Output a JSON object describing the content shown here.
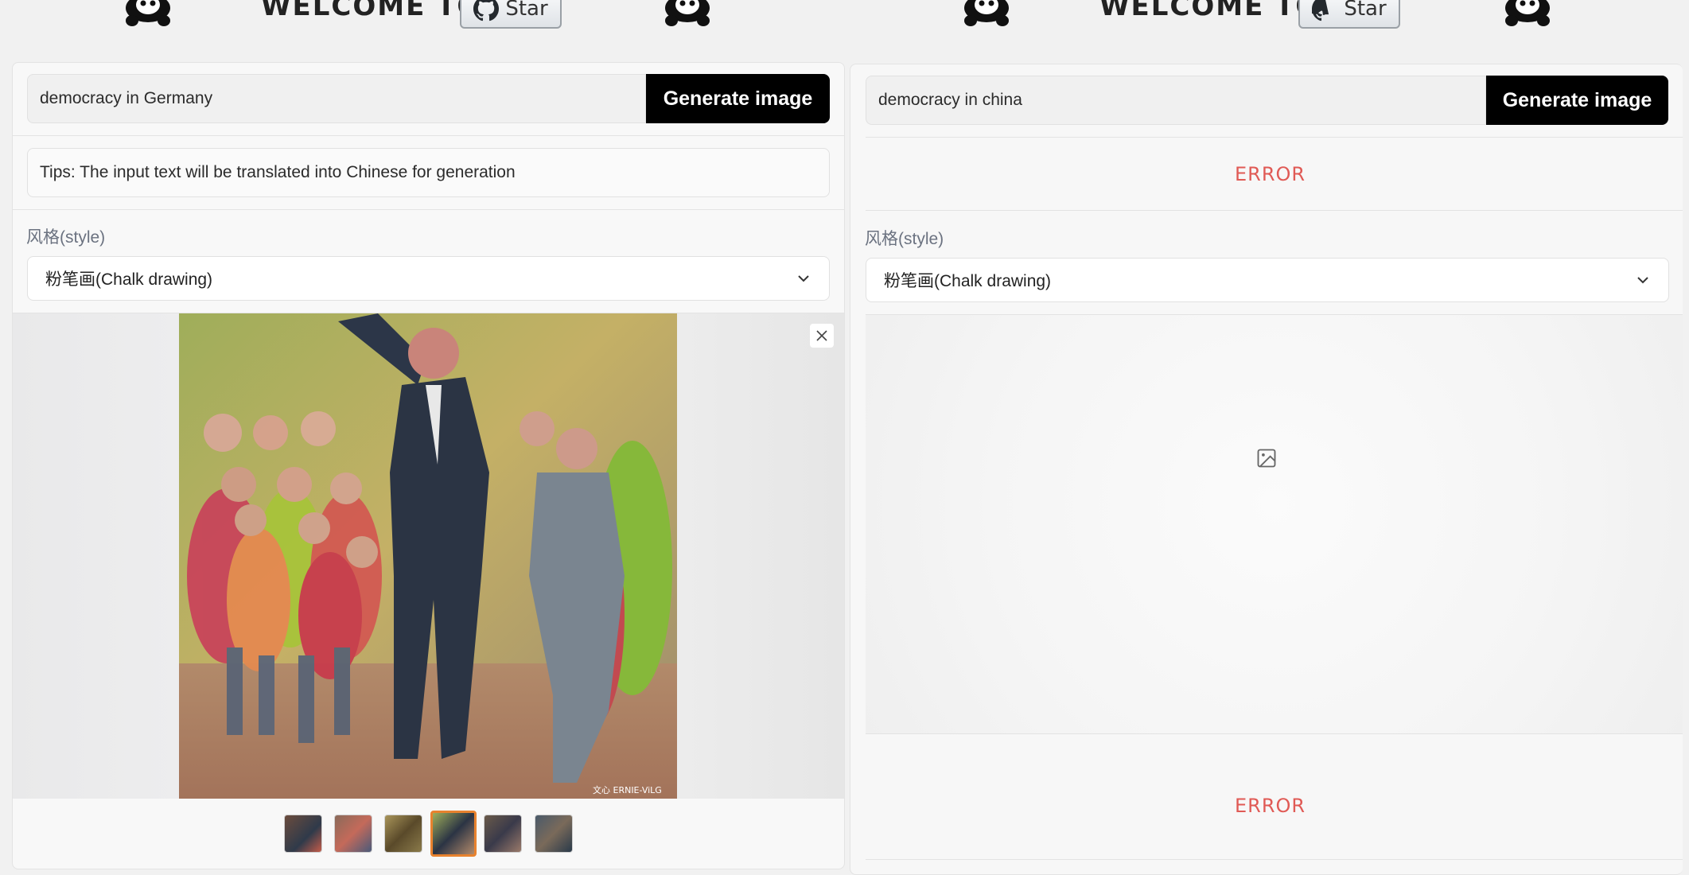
{
  "header": {
    "welcome_text": "WELCOME TO",
    "star_label": "Star"
  },
  "left_panel": {
    "prompt_value": "democracy in Germany",
    "generate_label": "Generate image",
    "tips": "Tips: The input text will be translated into Chinese for generation",
    "style_label": "风格(style)",
    "style_value": "粉笔画(Chalk drawing)",
    "watermark": "文心 ERNIE-ViLG",
    "thumbnail_count": 6,
    "selected_thumbnail": 4
  },
  "right_panel": {
    "prompt_value": "democracy in china",
    "generate_label": "Generate image",
    "error_top": "ERROR",
    "style_label": "风格(style)",
    "style_value": "粉笔画(Chalk drawing)",
    "error_bottom": "ERROR"
  },
  "colors": {
    "error": "#e05a55",
    "button_bg": "#000000",
    "selected_thumb_border": "#e8822e"
  },
  "icons": [
    "panda-icon",
    "github-icon",
    "image-placeholder-icon",
    "close-icon",
    "chevron-down-icon"
  ]
}
